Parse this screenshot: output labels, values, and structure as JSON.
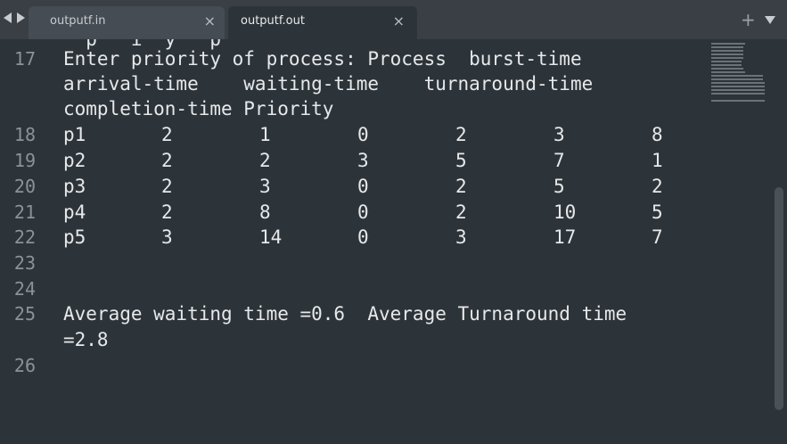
{
  "tabs": [
    {
      "label": "outputf.in",
      "active": false
    },
    {
      "label": "outputf.out",
      "active": true
    }
  ],
  "icons": {
    "close": "×",
    "new_tab": "+"
  },
  "editor": {
    "partial_top_line": "  p   i  y   p",
    "lines": [
      {
        "num": "17",
        "text": "Enter priority of process: Process  burst-time"
      },
      {
        "num": "",
        "text": "arrival-time    waiting-time    turnaround-time"
      },
      {
        "num": "",
        "text": "completion-time Priority"
      },
      {
        "num": "18",
        "cells": [
          "p1",
          "2",
          "1",
          "0",
          "2",
          "3",
          "8"
        ]
      },
      {
        "num": "19",
        "cells": [
          "p2",
          "2",
          "2",
          "3",
          "5",
          "7",
          "1"
        ]
      },
      {
        "num": "20",
        "cells": [
          "p3",
          "2",
          "3",
          "0",
          "2",
          "5",
          "2"
        ]
      },
      {
        "num": "21",
        "cells": [
          "p4",
          "2",
          "8",
          "0",
          "2",
          "10",
          "5"
        ]
      },
      {
        "num": "22",
        "cells": [
          "p5",
          "3",
          "14",
          "0",
          "3",
          "17",
          "7"
        ]
      },
      {
        "num": "23",
        "text": ""
      },
      {
        "num": "24",
        "text": ""
      },
      {
        "num": "25",
        "text": "Average waiting time =0.6  Average Turnaround time"
      },
      {
        "num": "",
        "text": "=2.8"
      },
      {
        "num": "26",
        "text": ""
      }
    ]
  },
  "colors": {
    "editor_bg": "#2d3439",
    "tab_active_bg": "#2d3439",
    "tab_inactive_bg": "#454c53",
    "text": "#e6e8ea",
    "line_number": "#8b9298"
  }
}
